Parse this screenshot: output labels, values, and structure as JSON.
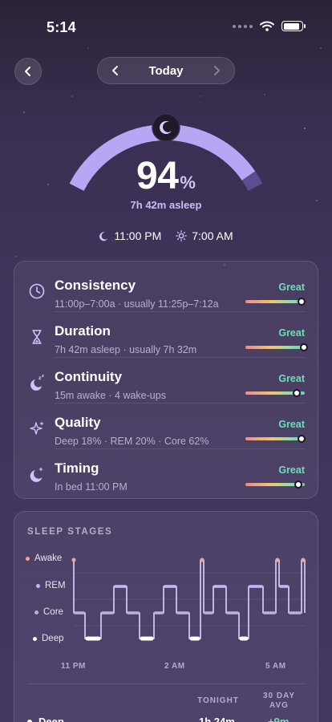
{
  "status_bar": {
    "time": "5:14"
  },
  "nav": {
    "date_label": "Today"
  },
  "summary": {
    "score": "94",
    "score_unit": "%",
    "score_fraction": 0.94,
    "asleep": "7h 42m asleep",
    "bedtime": "11:00 PM",
    "wake_time": "7:00 AM"
  },
  "metrics": [
    {
      "title": "Consistency",
      "subtitle": "11:00p–7:00a · usually 11:25p–7:12a",
      "rating": "Great",
      "level": 0.94,
      "icon": "clock-icon"
    },
    {
      "title": "Duration",
      "subtitle": "7h 42m asleep · usually 7h 32m",
      "rating": "Great",
      "level": 0.98,
      "icon": "hourglass-icon"
    },
    {
      "title": "Continuity",
      "subtitle": "15m awake · 4 wake-ups",
      "rating": "Great",
      "level": 0.86,
      "icon": "moon-zzz-icon"
    },
    {
      "title": "Quality",
      "subtitle": "Deep 18% · REM 20% · Core 62%",
      "rating": "Great",
      "level": 0.95,
      "icon": "sparkles-icon"
    },
    {
      "title": "Timing",
      "subtitle": "In bed 11:00 PM",
      "rating": "Great",
      "level": 0.89,
      "icon": "moon-star-icon"
    }
  ],
  "stages": {
    "heading": "SLEEP STAGES",
    "levels": [
      "Awake",
      "REM",
      "Core",
      "Deep"
    ],
    "level_colors": {
      "Awake": "#f2a5a0",
      "REM": "#c8b6ff",
      "Core": "#b9b3d6",
      "Deep": "#ffffff"
    },
    "x_ticks": [
      "11 PM",
      "2 AM",
      "5 AM"
    ],
    "table": {
      "col_tonight": "TONIGHT",
      "col_avg": "30 DAY AVG",
      "rows": [
        {
          "label": "Deep",
          "tonight": "1h 24m",
          "avg_delta": "+9m"
        }
      ]
    }
  },
  "colors": {
    "accent": "#b8a6f5",
    "great": "#6be0b3",
    "gauge_track": "#6e5fb0"
  }
}
